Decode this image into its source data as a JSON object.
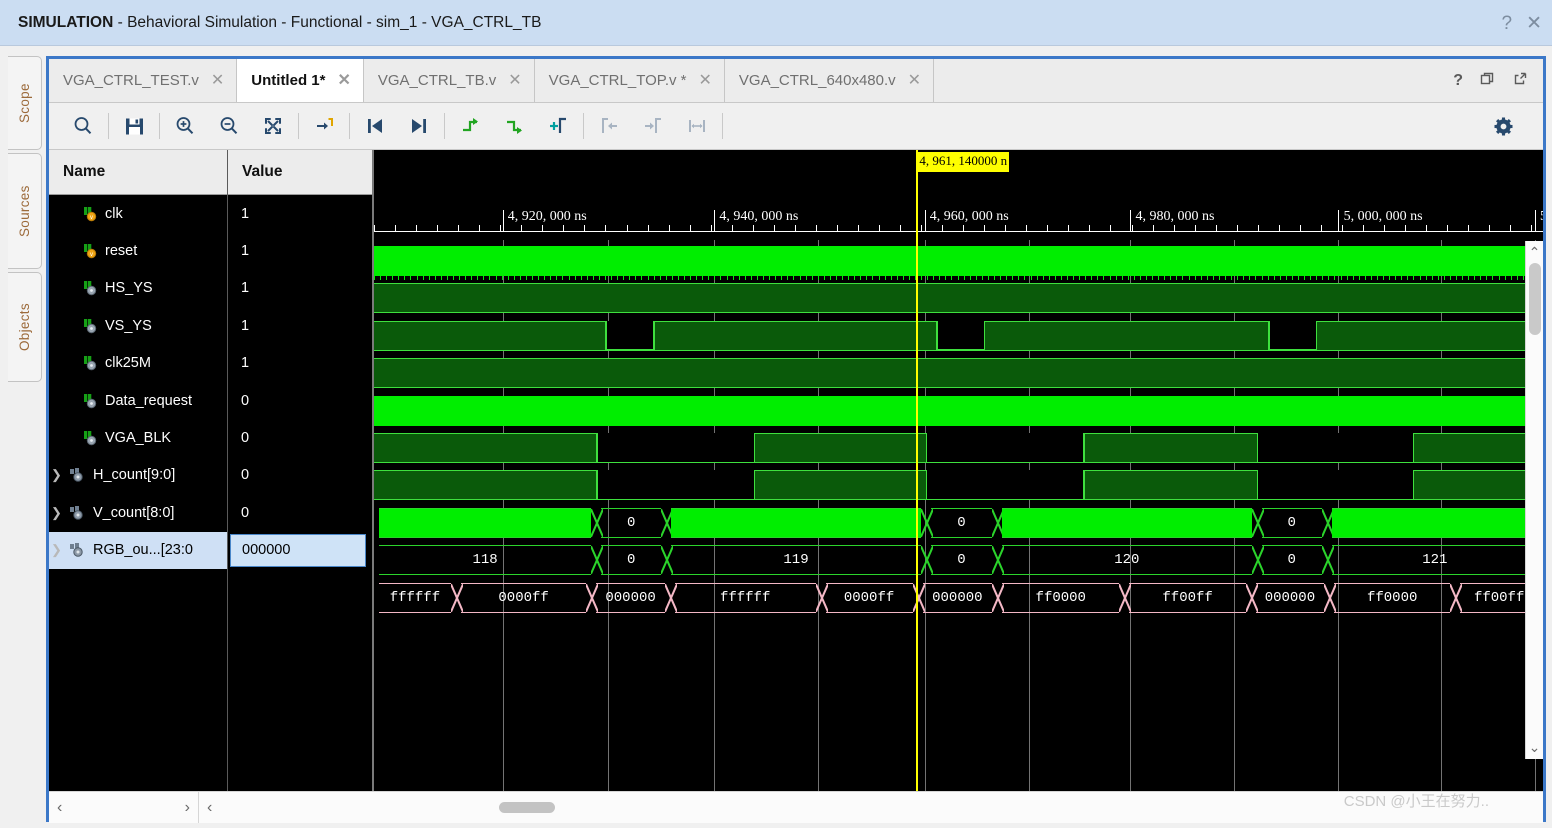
{
  "window": {
    "title_bold": "SIMULATION",
    "title_rest": " - Behavioral Simulation - Functional - sim_1 - VGA_CTRL_TB",
    "help_icon": "?",
    "close_icon": "✕"
  },
  "vertical_tabs": [
    {
      "label": "Scope"
    },
    {
      "label": "Sources"
    },
    {
      "label": "Objects"
    }
  ],
  "editor_tabs": [
    {
      "label": "VGA_CTRL_TEST.v",
      "active": false,
      "close": "✕"
    },
    {
      "label": "Untitled 1*",
      "active": true,
      "close": "✕"
    },
    {
      "label": "VGA_CTRL_TB.v",
      "active": false,
      "close": "✕"
    },
    {
      "label": "VGA_CTRL_TOP.v *",
      "active": false,
      "close": "✕"
    },
    {
      "label": "VGA_CTRL_640x480.v",
      "active": false,
      "close": "✕"
    }
  ],
  "tabrow_actions": [
    {
      "name": "help-icon",
      "glyph": "?"
    },
    {
      "name": "restore-window-icon",
      "glyph": "❐"
    },
    {
      "name": "float-window-icon",
      "glyph": "↗"
    }
  ],
  "toolbar": {
    "buttons": [
      {
        "name": "search-icon",
        "title": "Search"
      },
      {
        "name": "save-icon",
        "title": "Save"
      },
      {
        "name": "zoom-in-icon",
        "title": "Zoom In"
      },
      {
        "name": "zoom-out-icon",
        "title": "Zoom Out"
      },
      {
        "name": "zoom-fit-icon",
        "title": "Zoom Fit"
      },
      {
        "name": "go-to-time-icon",
        "title": "Go To Time 0"
      },
      {
        "name": "previous-transition-icon",
        "title": "Previous Transition"
      },
      {
        "name": "next-transition-icon",
        "title": "Next Transition"
      },
      {
        "name": "previous-marker-icon",
        "title": "Previous Marker"
      },
      {
        "name": "next-marker-icon",
        "title": "Next Marker"
      },
      {
        "name": "add-marker-icon",
        "title": "Add Marker"
      },
      {
        "name": "previous-edge-icon",
        "title": "Previous Edge"
      },
      {
        "name": "next-edge-icon",
        "title": "Next Edge"
      },
      {
        "name": "measure-span-icon",
        "title": "Measure Span"
      }
    ],
    "settings": {
      "name": "gear-icon",
      "title": "Settings"
    }
  },
  "table": {
    "headers": {
      "name": "Name",
      "value": "Value"
    },
    "signals": [
      {
        "name": "clk",
        "value": "1",
        "expandable": false,
        "kind": "logic",
        "selected": false
      },
      {
        "name": "reset",
        "value": "1",
        "expandable": false,
        "kind": "logic",
        "selected": false
      },
      {
        "name": "HS_YS",
        "value": "1",
        "expandable": false,
        "kind": "wire",
        "selected": false
      },
      {
        "name": "VS_YS",
        "value": "1",
        "expandable": false,
        "kind": "wire",
        "selected": false
      },
      {
        "name": "clk25M",
        "value": "1",
        "expandable": false,
        "kind": "wire",
        "selected": false
      },
      {
        "name": "Data_request",
        "value": "0",
        "expandable": false,
        "kind": "wire",
        "selected": false
      },
      {
        "name": "VGA_BLK",
        "value": "0",
        "expandable": false,
        "kind": "wire",
        "selected": false
      },
      {
        "name": "H_count[9:0]",
        "value": "0",
        "expandable": true,
        "kind": "bus",
        "selected": false
      },
      {
        "name": "V_count[8:0]",
        "value": "0",
        "expandable": true,
        "kind": "bus",
        "selected": false
      },
      {
        "name": "RGB_ou...[23:0",
        "value": "000000",
        "expandable": true,
        "kind": "bus",
        "selected": true
      }
    ]
  },
  "waveform": {
    "cursor_label": "4, 961, 140000 n",
    "cursor_x_pct": 46.4,
    "time_labels": [
      {
        "text": "4, 920, 000 ns",
        "x_pct": 11.1
      },
      {
        "text": "4, 940, 000 ns",
        "x_pct": 29.2
      },
      {
        "text": "4, 960, 000 ns",
        "x_pct": 47.2
      },
      {
        "text": "4, 980, 000 ns",
        "x_pct": 64.8
      },
      {
        "text": "5, 000, 000 ns",
        "x_pct": 82.6
      },
      {
        "text": "5",
        "x_pct": 99.4
      }
    ],
    "major_ticks_pct": [
      11.0,
      29.1,
      47.1,
      64.7,
      82.5,
      99.3
    ],
    "gridlines_pct": [
      11.0,
      20.0,
      29.1,
      38.0,
      47.1,
      56.0,
      64.7,
      73.6,
      82.5,
      91.3,
      99.3
    ],
    "rows": [
      {
        "signal": "clk",
        "type": "clock",
        "fill": "#00ee00"
      },
      {
        "signal": "reset",
        "type": "level",
        "value": 1
      },
      {
        "signal": "HS_YS",
        "type": "pulse",
        "low_windows_pct": [
          [
            19.8,
            24.0
          ],
          [
            48.1,
            52.3
          ],
          [
            76.5,
            80.7
          ]
        ]
      },
      {
        "signal": "VS_YS",
        "type": "level",
        "value": 1
      },
      {
        "signal": "clk25M",
        "type": "solid",
        "fill": "#00ee00"
      },
      {
        "signal": "Data_request",
        "type": "pulse",
        "low_windows_pct": [
          [
            19.0,
            32.6
          ],
          [
            47.2,
            60.8
          ],
          [
            75.5,
            89.0
          ]
        ]
      },
      {
        "signal": "VGA_BLK",
        "type": "pulse",
        "low_windows_pct": [
          [
            19.0,
            32.6
          ],
          [
            47.2,
            60.8
          ],
          [
            75.5,
            89.0
          ]
        ]
      },
      {
        "signal": "H_count[9:0]",
        "type": "bus_green_fill",
        "segments": [
          {
            "label": "",
            "start_pct": 0.0,
            "end_pct": 19.0,
            "fill": true
          },
          {
            "label": "0",
            "start_pct": 19.0,
            "end_pct": 25.0,
            "fill": false
          },
          {
            "label": "",
            "start_pct": 25.0,
            "end_pct": 47.2,
            "fill": true
          },
          {
            "label": "0",
            "start_pct": 47.2,
            "end_pct": 53.3,
            "fill": false
          },
          {
            "label": "",
            "start_pct": 53.3,
            "end_pct": 75.5,
            "fill": true
          },
          {
            "label": "0",
            "start_pct": 75.5,
            "end_pct": 81.5,
            "fill": false
          },
          {
            "label": "",
            "start_pct": 81.5,
            "end_pct": 100.0,
            "fill": true
          }
        ]
      },
      {
        "signal": "V_count[8:0]",
        "type": "bus_green",
        "segments": [
          {
            "label": "118",
            "start_pct": 0.0,
            "end_pct": 19.0
          },
          {
            "label": "0",
            "start_pct": 19.0,
            "end_pct": 25.0
          },
          {
            "label": "119",
            "start_pct": 25.0,
            "end_pct": 47.2
          },
          {
            "label": "0",
            "start_pct": 47.2,
            "end_pct": 53.3
          },
          {
            "label": "120",
            "start_pct": 53.3,
            "end_pct": 75.5
          },
          {
            "label": "0",
            "start_pct": 75.5,
            "end_pct": 81.5
          },
          {
            "label": "121",
            "start_pct": 81.5,
            "end_pct": 100.0
          }
        ]
      },
      {
        "signal": "RGB_ou...[23:0",
        "type": "bus_pink",
        "segments": [
          {
            "label": "ffffff",
            "start_pct": 0.0,
            "end_pct": 7.0
          },
          {
            "label": "0000ff",
            "start_pct": 7.0,
            "end_pct": 18.6
          },
          {
            "label": "000000",
            "start_pct": 18.6,
            "end_pct": 25.3
          },
          {
            "label": "ffffff",
            "start_pct": 25.3,
            "end_pct": 38.2
          },
          {
            "label": "0000ff",
            "start_pct": 38.2,
            "end_pct": 46.5
          },
          {
            "label": "000000",
            "start_pct": 46.5,
            "end_pct": 53.3
          },
          {
            "label": "ff0000",
            "start_pct": 53.3,
            "end_pct": 64.2
          },
          {
            "label": "ff00ff",
            "start_pct": 64.2,
            "end_pct": 75.0
          },
          {
            "label": "000000",
            "start_pct": 75.0,
            "end_pct": 81.7
          },
          {
            "label": "ff0000",
            "start_pct": 81.7,
            "end_pct": 92.5
          },
          {
            "label": "ff00ff",
            "start_pct": 92.5,
            "end_pct": 100.0
          }
        ]
      }
    ]
  },
  "scrollbars": {
    "left_prev": "‹",
    "left_next": "›",
    "wave_prev": "‹",
    "vert_up": "⌃",
    "vert_down": "⌄"
  },
  "watermark": "CSDN @小王在努力..",
  "colors": {
    "title_bg": "#cbddf2",
    "panel_border": "#3c78c8",
    "wave_high": "#00ee00",
    "wave_dim": "#0a5a0a",
    "wave_edge": "#3ee03e",
    "bus_pink": "#f4b8c6",
    "cursor": "#ffff00",
    "selection": "#cfe0f5"
  }
}
